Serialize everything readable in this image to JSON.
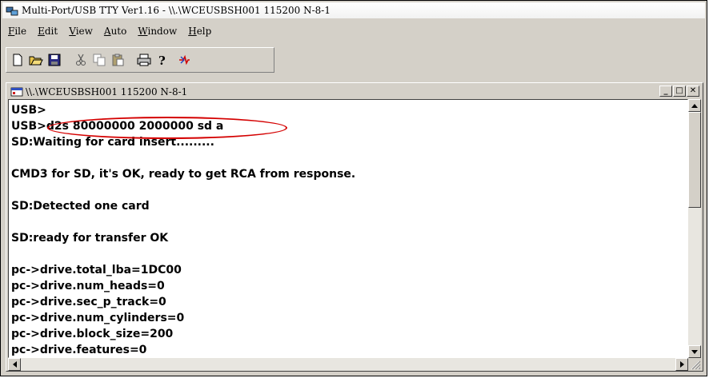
{
  "app": {
    "title": "Multi-Port/USB TTY Ver1.16 - \\\\.\\WCEUSBSH001 115200  N-8-1"
  },
  "menu": [
    {
      "key": "F",
      "rest": "ile"
    },
    {
      "key": "E",
      "rest": "dit"
    },
    {
      "key": "V",
      "rest": "iew"
    },
    {
      "key": "A",
      "rest": "uto"
    },
    {
      "key": "W",
      "rest": "indow"
    },
    {
      "key": "H",
      "rest": "elp"
    }
  ],
  "toolbar": {
    "icons": [
      "new-icon",
      "open-icon",
      "save-icon",
      "cut-icon",
      "copy-icon",
      "paste-icon",
      "print-icon",
      "help-icon",
      "connect-icon"
    ]
  },
  "child": {
    "title": "\\\\.\\WCEUSBSH001 115200  N-8-1",
    "minimize": "_",
    "maximize": "□",
    "close": "✕"
  },
  "terminal": {
    "lines": [
      "USB>",
      "USB>d2s 80000000 2000000 sd a",
      "SD:Waiting for card insert.........",
      "",
      "CMD3 for SD, it's OK, ready to get RCA from response.",
      "",
      "SD:Detected one card",
      "",
      "SD:ready for transfer OK",
      "",
      "pc->drive.total_lba=1DC00",
      "pc->drive.num_heads=0",
      "pc->drive.sec_p_track=0",
      "pc->drive.num_cylinders=0",
      "pc->drive.block_size=200",
      "pc->drive.features=0"
    ]
  },
  "colors": {
    "annotation": "#d40000",
    "window_face": "#d4d0c8"
  }
}
